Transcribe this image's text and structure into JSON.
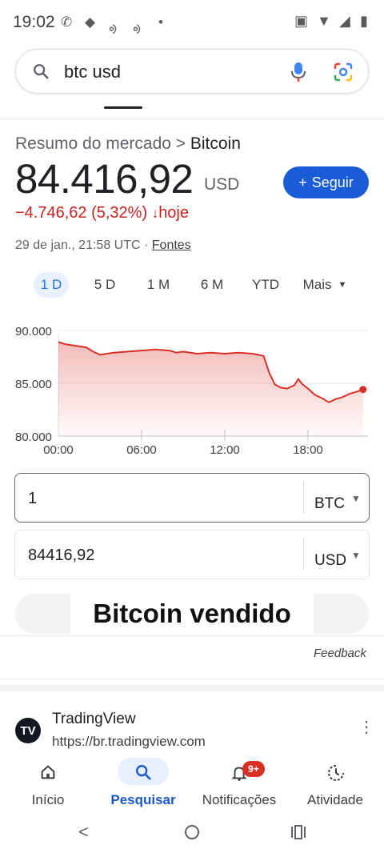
{
  "status_bar": {
    "time": "19:02"
  },
  "search": {
    "query": "btc usd"
  },
  "finance": {
    "breadcrumb_prefix": "Resumo do mercado > ",
    "breadcrumb_name": "Bitcoin",
    "price": "84.416,92",
    "currency": "USD",
    "follow_label": "Seguir",
    "change": "−4.746,62 (5,32%)",
    "change_suffix": "hoje",
    "date_text": "29 de jan., 21:58 UTC · ",
    "sources_link": "Fontes",
    "ranges": [
      "1 D",
      "5 D",
      "1 M",
      "6 M",
      "YTD",
      "Mais"
    ],
    "active_range": "1 D"
  },
  "chart_data": {
    "type": "area",
    "y_ticks": [
      "90.000",
      "85.000",
      "80.000"
    ],
    "x_ticks": [
      "00:00",
      "06:00",
      "12:00",
      "18:00"
    ],
    "ylim": [
      80000,
      90000
    ],
    "series_color": "#d93025",
    "points": [
      [
        0.0,
        88900
      ],
      [
        0.5,
        88700
      ],
      [
        1.0,
        88600
      ],
      [
        1.5,
        88500
      ],
      [
        2.0,
        88400
      ],
      [
        2.5,
        88000
      ],
      [
        3.0,
        87700
      ],
      [
        3.5,
        87800
      ],
      [
        4.0,
        87900
      ],
      [
        5.0,
        88000
      ],
      [
        6.0,
        88100
      ],
      [
        7.0,
        88200
      ],
      [
        8.0,
        88100
      ],
      [
        8.5,
        87900
      ],
      [
        9.0,
        88000
      ],
      [
        10.0,
        87800
      ],
      [
        11.0,
        87900
      ],
      [
        12.0,
        87800
      ],
      [
        13.0,
        87900
      ],
      [
        14.0,
        87800
      ],
      [
        14.8,
        87600
      ],
      [
        15.2,
        86000
      ],
      [
        15.6,
        84900
      ],
      [
        16.0,
        84600
      ],
      [
        16.5,
        84500
      ],
      [
        17.0,
        84800
      ],
      [
        17.3,
        85400
      ],
      [
        17.6,
        84900
      ],
      [
        18.0,
        84500
      ],
      [
        18.5,
        83900
      ],
      [
        19.0,
        83600
      ],
      [
        19.5,
        83200
      ],
      [
        20.0,
        83500
      ],
      [
        20.5,
        83700
      ],
      [
        21.0,
        84000
      ],
      [
        21.5,
        84200
      ],
      [
        21.97,
        84417
      ]
    ]
  },
  "converter": {
    "from_value": "1",
    "from_currency": "BTC",
    "to_value": "84416,92",
    "to_currency": "USD"
  },
  "overlay_text": "Bitcoin vendido",
  "feedback_label": "Feedback",
  "result": {
    "logo_text": "TV",
    "name": "TradingView",
    "url": "https://br.tradingview.com"
  },
  "bottom_nav": [
    {
      "label": "Início",
      "icon": "home-icon",
      "active": false
    },
    {
      "label": "Pesquisar",
      "icon": "search-icon",
      "active": true
    },
    {
      "label": "Notificações",
      "icon": "bell-icon",
      "active": false,
      "badge": "9+"
    },
    {
      "label": "Atividade",
      "icon": "activity-icon",
      "active": false
    }
  ],
  "colors": {
    "accent": "#1a5bd6",
    "negative": "#c5221f"
  }
}
